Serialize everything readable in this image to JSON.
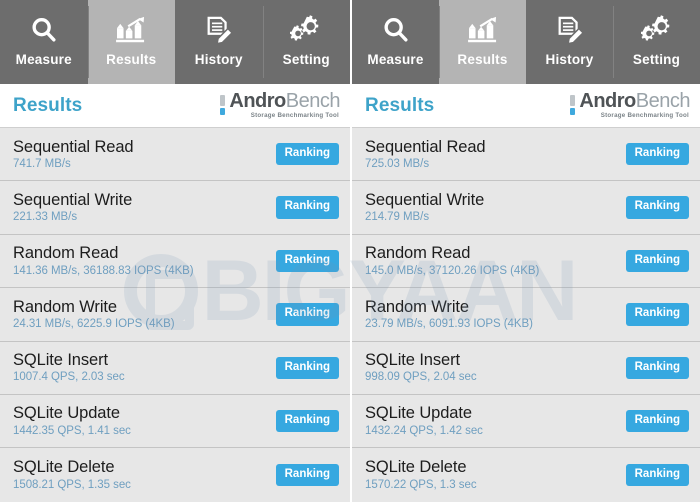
{
  "watermark": {
    "text": "BIGYAAN",
    "logo_icon": "mobigyaan-logo-icon"
  },
  "tabs": [
    {
      "label": "Measure",
      "icon": "magnifier-icon",
      "active": false
    },
    {
      "label": "Results",
      "icon": "bar-chart-arrow-icon",
      "active": true
    },
    {
      "label": "History",
      "icon": "document-pen-icon",
      "active": false
    },
    {
      "label": "Setting",
      "icon": "gears-icon",
      "active": false
    }
  ],
  "header": {
    "title": "Results",
    "logo_name": "AndroBench",
    "logo_part1": "Andro",
    "logo_part2": "Bench",
    "logo_tagline": "Storage Benchmarking Tool"
  },
  "colors": {
    "accent_blue": "#36a8e0",
    "title_blue": "#3ea3c9",
    "value_blue": "#6f9fc0",
    "tabbar_gray": "#6d6d6d",
    "tab_active_gray": "#b4b4b4",
    "row_gray": "#e7e7e7"
  },
  "rank_button_label": "Ranking",
  "panels": [
    {
      "device_side": "left",
      "rows": [
        {
          "title": "Sequential Read",
          "value": "741.7 MB/s"
        },
        {
          "title": "Sequential Write",
          "value": "221.33 MB/s"
        },
        {
          "title": "Random Read",
          "value": "141.36 MB/s, 36188.83 IOPS (4KB)"
        },
        {
          "title": "Random Write",
          "value": "24.31 MB/s, 6225.9 IOPS (4KB)"
        },
        {
          "title": "SQLite Insert",
          "value": "1007.4 QPS, 2.03 sec"
        },
        {
          "title": "SQLite Update",
          "value": "1442.35 QPS, 1.41 sec"
        },
        {
          "title": "SQLite Delete",
          "value": "1508.21 QPS, 1.35 sec"
        }
      ]
    },
    {
      "device_side": "right",
      "rows": [
        {
          "title": "Sequential Read",
          "value": "725.03 MB/s"
        },
        {
          "title": "Sequential Write",
          "value": "214.79 MB/s"
        },
        {
          "title": "Random Read",
          "value": "145.0 MB/s, 37120.26 IOPS (4KB)"
        },
        {
          "title": "Random Write",
          "value": "23.79 MB/s, 6091.93 IOPS (4KB)"
        },
        {
          "title": "SQLite Insert",
          "value": "998.09 QPS, 2.04 sec"
        },
        {
          "title": "SQLite Update",
          "value": "1432.24 QPS, 1.42 sec"
        },
        {
          "title": "SQLite Delete",
          "value": "1570.22 QPS, 1.3 sec"
        }
      ]
    }
  ]
}
